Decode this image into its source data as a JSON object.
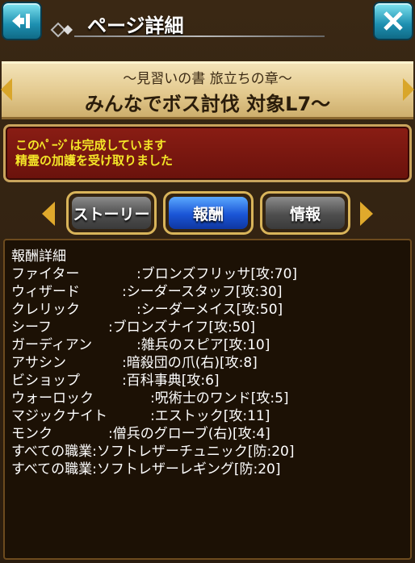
{
  "header": {
    "title": "ページ詳細"
  },
  "banner": {
    "subtitle": "〜見習いの書 旅立ちの章〜",
    "title": "みんなでボス討伐 対象L7〜"
  },
  "status": {
    "line1": "このﾍﾟｰｼﾞは完成しています",
    "line2": "精霊の加護を受け取りました"
  },
  "tabs": {
    "story": "ストーリー",
    "reward": "報酬",
    "info": "情報"
  },
  "details": {
    "title": "報酬詳細",
    "rows": [
      {
        "job": "ファイター",
        "item": ":ブロンズフリッサ[攻:70]"
      },
      {
        "job": "ウィザード",
        "item": ":シーダースタッフ[攻:30]"
      },
      {
        "job": "クレリック",
        "item": ":シーダーメイス[攻:50]"
      },
      {
        "job": "シーフ",
        "item": ":ブロンズナイフ[攻:50]"
      },
      {
        "job": "ガーディアン",
        "item": ":雑兵のスピア[攻:10]"
      },
      {
        "job": "アサシン",
        "item": ":暗殺団の爪(右)[攻:8]"
      },
      {
        "job": "ビショップ",
        "item": ":百科事典[攻:6]"
      },
      {
        "job": "ウォーロック",
        "item": ":呪術士のワンド[攻:5]"
      },
      {
        "job": "マジックナイト",
        "item": ":エストック[攻:11]"
      },
      {
        "job": "モンク",
        "item": ":僧兵のグローブ(右)[攻:4]"
      },
      {
        "job": "すべての職業",
        "item": ":ソフトレザーチュニック[防:20]"
      },
      {
        "job": "すべての職業",
        "item": ":ソフトレザーレギング[防:20]"
      }
    ]
  }
}
